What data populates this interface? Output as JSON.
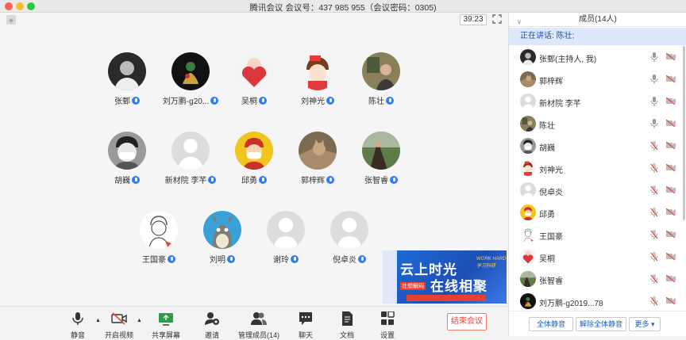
{
  "window": {
    "title": "腾讯会议 会议号：437 985 955（会议密码：0305)"
  },
  "meeting": {
    "timer": "39:23"
  },
  "participants": [
    {
      "name": "张鄄",
      "avatar": "photo-dark"
    },
    {
      "name": "刘万鹏-g20...",
      "avatar": "photo-black"
    },
    {
      "name": "吴桐",
      "avatar": "cartoon-heart"
    },
    {
      "name": "刘神光",
      "avatar": "cartoon-boy"
    },
    {
      "name": "陈壮",
      "avatar": "photo-room"
    },
    {
      "name": "胡巍",
      "avatar": "photo-mask"
    },
    {
      "name": "新材院 李芊",
      "avatar": "default"
    },
    {
      "name": "邱勇",
      "avatar": "cartoon-mask"
    },
    {
      "name": "郭梓辉",
      "avatar": "photo-cat"
    },
    {
      "name": "张智睿",
      "avatar": "photo-outdoor"
    },
    {
      "name": "王国豪",
      "avatar": "sketch"
    },
    {
      "name": "刘明",
      "avatar": "totoro"
    },
    {
      "name": "谢玲",
      "avatar": "default"
    },
    {
      "name": "倪卓炎",
      "avatar": "default"
    }
  ],
  "screen_share": {
    "line1": "云上时光",
    "line2": "在线相聚",
    "tag": "WORK HARD 学习科研",
    "tag2": "壮想解闷"
  },
  "toolbar": {
    "mute": "静音",
    "video": "开启视频",
    "share": "共享屏幕",
    "invite": "邀请",
    "manage": "管理成员(14)",
    "chat": "聊天",
    "docs": "文档",
    "settings": "设置",
    "end": "结束会议"
  },
  "panel": {
    "title": "成员(14人)",
    "speaking": "正在讲话: 陈壮;",
    "members": [
      {
        "name": "张鄄(主持人, 我)",
        "mic": "on",
        "avatar": "photo-dark"
      },
      {
        "name": "郭梓辉",
        "mic": "on",
        "avatar": "photo-cat"
      },
      {
        "name": "新材院 李芊",
        "mic": "on",
        "avatar": "default"
      },
      {
        "name": "陈壮",
        "mic": "on",
        "avatar": "photo-room"
      },
      {
        "name": "胡巍",
        "mic": "off",
        "avatar": "photo-mask"
      },
      {
        "name": "刘神光",
        "mic": "off",
        "avatar": "cartoon-boy"
      },
      {
        "name": "倪卓炎",
        "mic": "off",
        "avatar": "default"
      },
      {
        "name": "邱勇",
        "mic": "off",
        "avatar": "cartoon-mask"
      },
      {
        "name": "王国豪",
        "mic": "off",
        "avatar": "sketch"
      },
      {
        "name": "吴桐",
        "mic": "off",
        "avatar": "cartoon-heart"
      },
      {
        "name": "张智睿",
        "mic": "off",
        "avatar": "photo-outdoor"
      },
      {
        "name": "刘万鹏-g2019...78",
        "mic": "off",
        "avatar": "photo-black"
      }
    ],
    "mute_all": "全体静音",
    "unmute_all": "解除全体静音",
    "more": "更多 ▾"
  },
  "colors": {
    "accent": "#2f7df6",
    "end": "#e9453b",
    "speaking_bg": "#dde8fb"
  }
}
